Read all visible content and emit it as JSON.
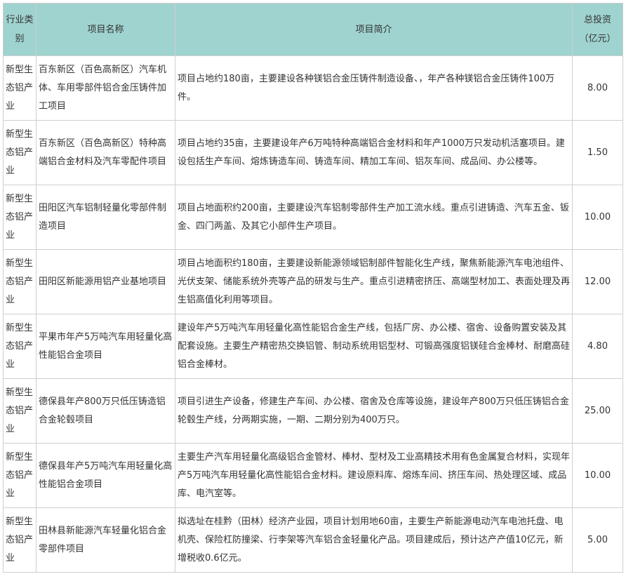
{
  "table": {
    "headers": {
      "category": "行业类别",
      "name": "项目名称",
      "summary": "项目简介",
      "investment_line1": "总投资",
      "investment_line2": "（亿元）"
    },
    "rows": [
      {
        "category": "新型生态铝产业",
        "name": "百东新区（百色高新区）汽车机体、车用零部件铝合金压铸件加工项目",
        "summary": "项目占地约180亩，主要建设各种镁铝合金压铸件制造设备、，年产各种镁铝合金压铸件100万件。",
        "investment": "8.00"
      },
      {
        "category": "新型生态铝产业",
        "name": "百东新区（百色高新区）特种高端铝合金材料及汽车零配件项目",
        "summary": "项目占地约35亩，主要建设年产6万吨特种高端铝合金材料和年产1000万只发动机活塞项目。建设包括生产车间、熔炼铸造车间、铸造车间、精加工车间、铝灰车间、成品间、办公楼等。",
        "investment": "1.50"
      },
      {
        "category": "新型生态铝产业",
        "name": "田阳区汽车铝制轻量化零部件制造项目",
        "summary": "项目占地面积约200亩，主要建设汽车铝制零部件生产加工流水线。重点引进铸造、汽车五金、钣金、四门两盖、及其它小部件生产项目。",
        "investment": "10.00"
      },
      {
        "category": "新型生态铝产业",
        "name": "田阳区新能源用铝产业基地项目",
        "summary": "项目占地面积约180亩，主要建设新能源领域铝制部件智能化生产线，聚焦新能源汽车电池组件、光伏支架、储能系统外壳等产品的研发与生产。重点引进精密挤压、高端型材加工、表面处理及再生铝高值化利用等项目。",
        "investment": "12.00"
      },
      {
        "category": "新型生态铝产业",
        "name": "平果市年产5万吨汽车用轻量化高性能铝合金项目",
        "summary": "建设年产5万吨汽车用轻量化高性能铝合金生产线，包括厂房、办公楼、宿舍、设备购置安装及其配套设施。主要生产精密热交换铝管、制动系统用铝型材、可锻高强度铝镁硅合金棒材、耐磨高硅铝合金棒材。",
        "investment": "4.80"
      },
      {
        "category": "新型生态铝产业",
        "name": "德保县年产800万只低压铸造铝合金轮毂项目",
        "summary": "项目引进生产设备，修建生产车间、办公楼、宿舍及仓库等设施，建设年产800万只低压铸铝合金轮毂生产线，分两期实施，一期、二期分别为400万只。",
        "investment": "25.00"
      },
      {
        "category": "新型生态铝产业",
        "name": "德保县年产5万吨汽车用轻量化高性能铝合金项目",
        "summary": "主要生产汽车用轻量化高级铝合金管材、棒材、型材及工业高精技术用有色金属复合材料，实现年产5万吨汽车用轻量化高性能铝合金材料。建设原料库、熔炼车间、挤压车间、热处理区域、成品库、电汽室等。",
        "investment": "10.00"
      },
      {
        "category": "新型生态铝产业",
        "name": "田林县新能源汽车轻量化铝合金零部件项目",
        "summary": "拟选址在桂黔（田林）经济产业园，项目计划用地60亩，主要生产新能源电动汽车电池托盘、电机壳、保险杠防撞梁、行李架等汽车铝合金轻量化产品。项目建成后，预计达产产值10亿元，新增税收0.6亿元。",
        "investment": "5.00"
      }
    ]
  }
}
